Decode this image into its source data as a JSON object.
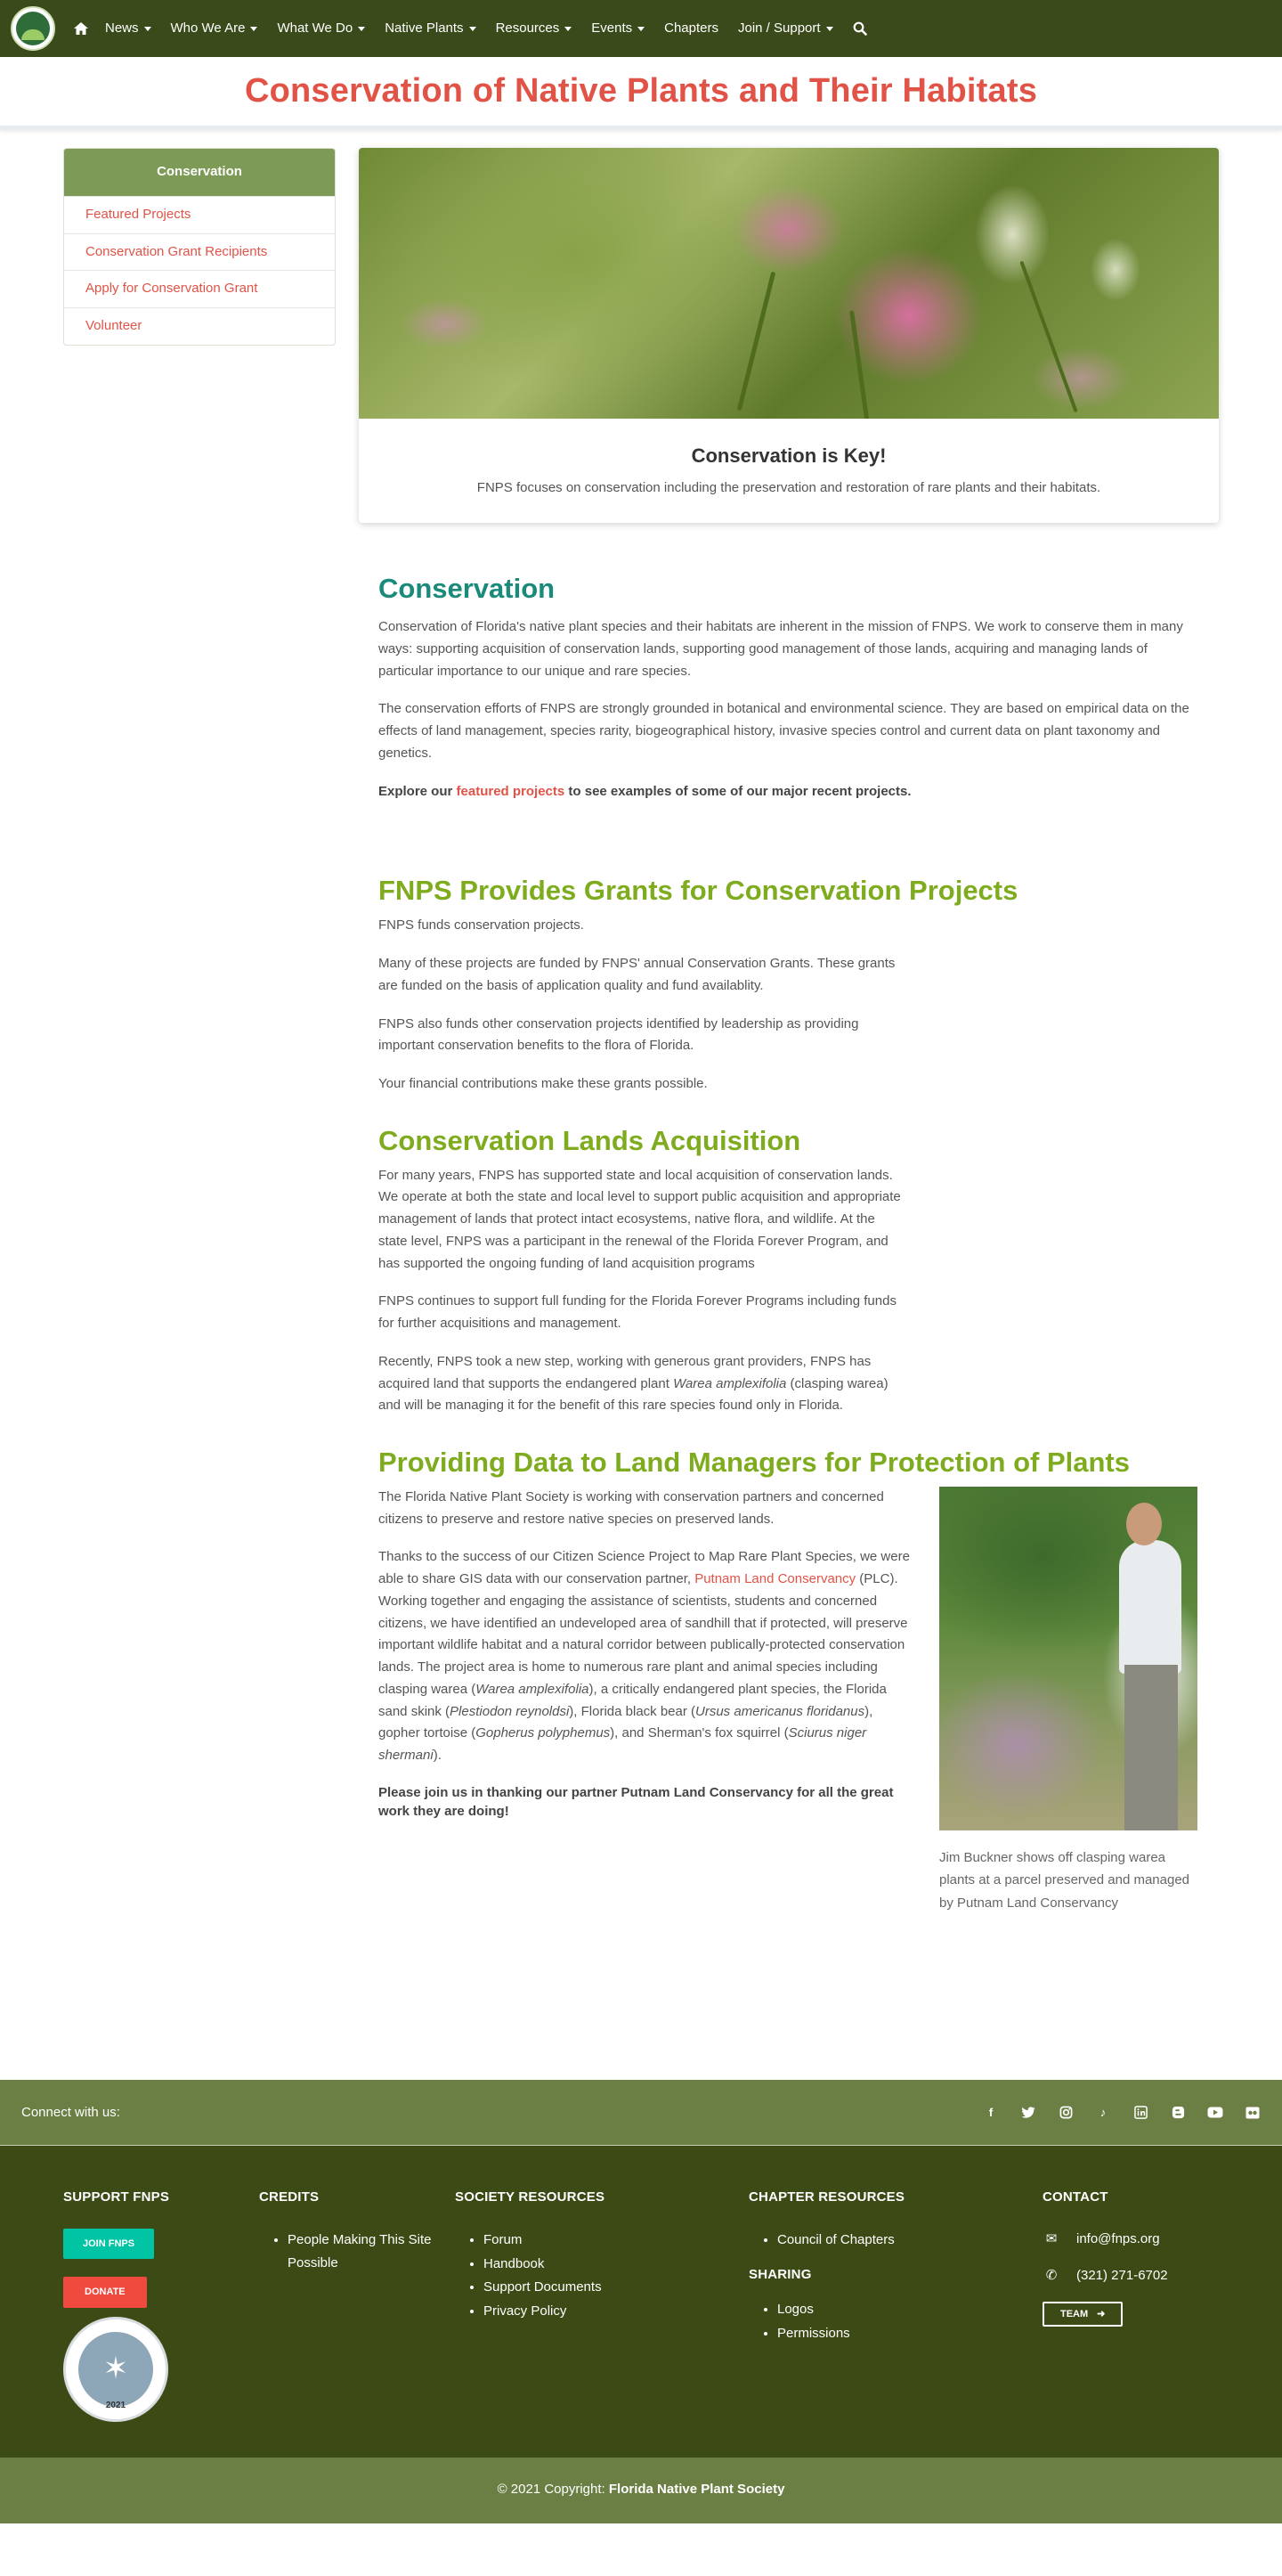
{
  "nav": {
    "items": [
      {
        "label": "News",
        "dropdown": true
      },
      {
        "label": "Who We Are",
        "dropdown": true
      },
      {
        "label": "What We Do",
        "dropdown": true
      },
      {
        "label": "Native Plants",
        "dropdown": true
      },
      {
        "label": "Resources",
        "dropdown": true
      },
      {
        "label": "Events",
        "dropdown": true
      },
      {
        "label": "Chapters",
        "dropdown": false
      },
      {
        "label": "Join / Support",
        "dropdown": true
      }
    ]
  },
  "page_title": "Conservation of Native Plants and Their Habitats",
  "sidebar": {
    "heading": "Conservation",
    "links": [
      "Featured Projects",
      "Conservation Grant Recipients",
      "Apply for Conservation Grant",
      "Volunteer"
    ]
  },
  "hero": {
    "title": "Conservation is Key!",
    "text": "FNPS focuses on conservation including the preservation and restoration of rare plants and their habitats."
  },
  "conservation": {
    "heading": "Conservation",
    "p1": "Conservation of Florida's native plant species and their habitats are inherent in the mission of FNPS.  We work to conserve them in many ways:  supporting acquisition of conservation lands, supporting good management of those lands, acquiring and managing lands of particular importance to our unique and rare species.",
    "p2": "The conservation efforts of FNPS are strongly grounded in botanical and environmental science.  They are based on empirical data on the effects of land management, species rarity, biogeographical history, invasive species control and current data on plant taxonomy and genetics.",
    "explore_before": "Explore our ",
    "explore_link": "featured projects",
    "explore_after": " to see examples of some of our major recent projects."
  },
  "grants": {
    "heading": "FNPS Provides Grants for Conservation Projects",
    "p1": "FNPS funds conservation projects.",
    "p2": "Many of these projects are funded by FNPS' annual Conservation Grants.  These grants are funded on the basis of application quality and fund availablity.",
    "p3": "FNPS also funds other conservation projects identified by leadership as providing important conservation benefits to the flora of Florida.",
    "p4": "Your financial contributions make these grants possible."
  },
  "lands": {
    "heading": "Conservation Lands Acquisition",
    "p1": "For many years, FNPS has supported state and local acquisition of conservation lands. We operate at both the state and local level to support public acquisition and appropriate management of lands that protect intact ecosystems, native flora, and wildlife. At the state level, FNPS was a participant in the renewal of the Florida Forever Program, and has supported the ongoing funding of land acquisition programs",
    "p2": "FNPS continues to support full funding for the Florida Forever Programs including funds for further acquisitions and management.",
    "p3_before": "Recently, FNPS took a new step, working with generous grant providers, FNPS has acquired land that supports the endangered plant ",
    "p3_italic": "Warea amplexifolia",
    "p3_after": " (clasping warea) and will be managing it for the benefit of this rare species found only in Florida."
  },
  "data_section": {
    "heading": "Providing Data to Land Managers for Protection of Plants",
    "p1": "The Florida Native Plant Society is working with conservation partners and concerned citizens to preserve and restore native species on preserved lands.",
    "p2_a": "Thanks to the success of our Citizen Science Project to Map Rare Plant Species, we were able to share GIS data with our conservation partner, ",
    "p2_link": "Putnam Land Conservancy",
    "p2_b": " (PLC).  Working together and engaging the assistance of scientists, students and concerned citizens, we have identified an undeveloped area of sandhill that if protected, will preserve important wildlife habitat and a natural corridor between publically-protected conservation lands.  The project area is home to numerous rare plant and animal species including clasping warea (",
    "p2_i1": "Warea amplexifolia",
    "p2_c": "), a critically endangered plant species, the Florida sand skink (",
    "p2_i2": "Plestiodon reynoldsi",
    "p2_d": "), Florida black bear (",
    "p2_i3": "Ursus americanus floridanus",
    "p2_e": "), gopher tortoise (",
    "p2_i4": "Gopherus polyphemus",
    "p2_f": "), and Sherman's fox squirrel (",
    "p2_i5": "Sciurus niger shermani",
    "p2_g": ").",
    "p3": "Please join us in thanking our partner Putnam Land Conservancy for all the great work they are doing!",
    "caption": "Jim Buckner shows off clasping warea plants at a parcel preserved and managed by Putnam Land Conservancy"
  },
  "connect": {
    "label": "Connect with us:",
    "icons": [
      "facebook-icon",
      "twitter-icon",
      "instagram-icon",
      "tiktok-icon",
      "linkedin-icon",
      "blogger-icon",
      "youtube-icon",
      "flickr-icon"
    ]
  },
  "footer": {
    "support": {
      "heading": "SUPPORT FNPS",
      "join": "JOIN FNPS",
      "donate": "DONATE",
      "seal_year": "2021"
    },
    "credits": {
      "heading": "CREDITS",
      "items": [
        "People Making This Site Possible"
      ]
    },
    "society": {
      "heading": "SOCIETY RESOURCES",
      "items": [
        "Forum",
        "Handbook",
        "Support Documents",
        "Privacy Policy"
      ]
    },
    "chapter": {
      "heading": "CHAPTER RESOURCES",
      "items": [
        "Council of Chapters"
      ]
    },
    "sharing": {
      "heading": "SHARING",
      "items": [
        "Logos",
        "Permissions"
      ]
    },
    "contact": {
      "heading": "CONTACT",
      "email": "info@fnps.org",
      "phone": "(321) 271-6702",
      "team": "TEAM"
    }
  },
  "copyright": {
    "prefix": "© 2021 Copyright: ",
    "org": "Florida Native Plant Society"
  },
  "colors": {
    "nav_bg": "#3a4a1b",
    "title_red": "#e25347",
    "heading_teal": "#1a8a7a",
    "heading_green": "#7fac1e",
    "footer_bg": "#3c4a16",
    "band_bg": "#6b7f45"
  }
}
